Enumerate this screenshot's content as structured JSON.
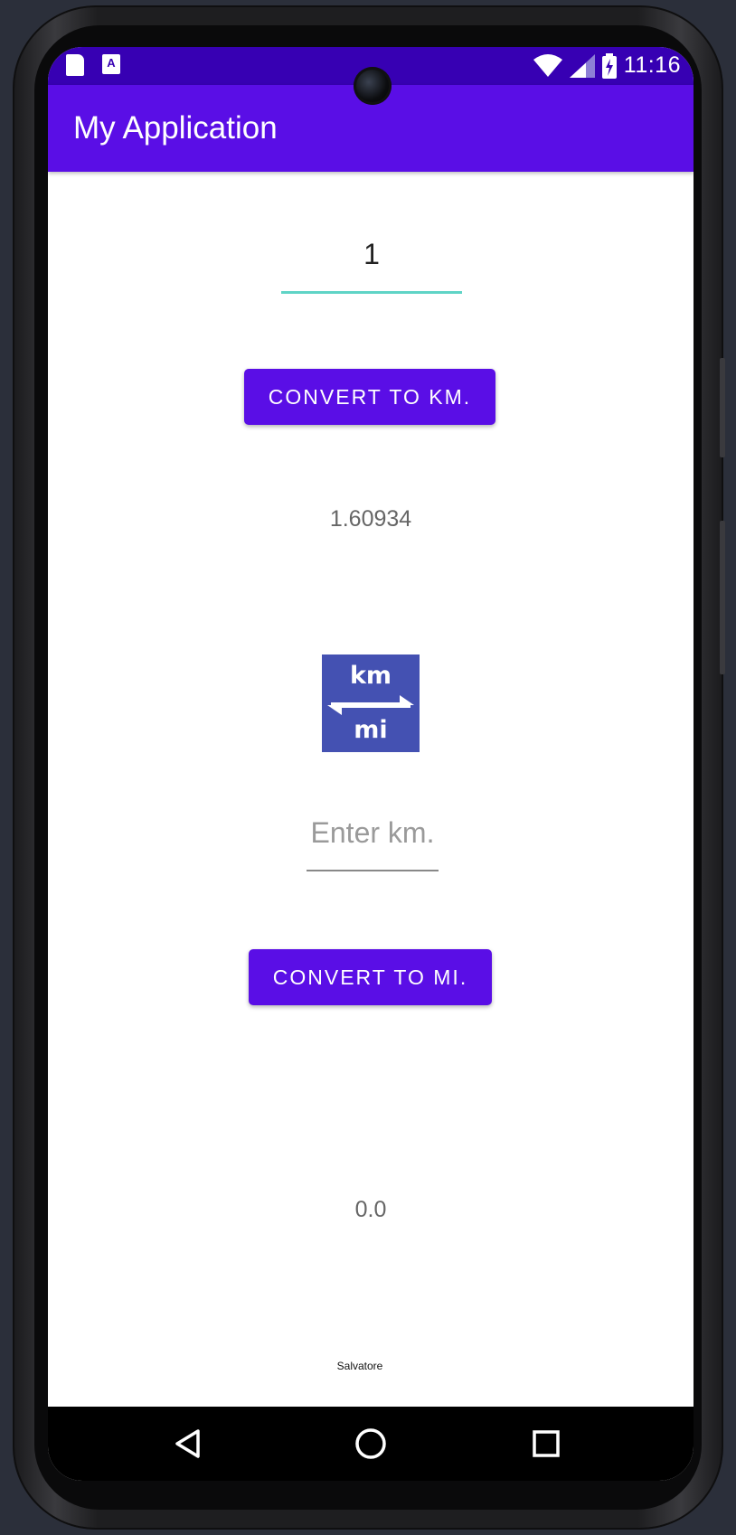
{
  "status_bar": {
    "time": "11:16",
    "icons": [
      "sd-card-icon",
      "a-text-icon",
      "wifi-icon",
      "cell-signal-icon",
      "battery-charging-icon"
    ]
  },
  "app_bar": {
    "title": "My Application"
  },
  "miles_input": {
    "value": "1"
  },
  "convert_km_button": {
    "label": "CONVERT TO KM."
  },
  "km_result": "1.60934",
  "logo": {
    "top_text": "km",
    "bottom_text": "mi"
  },
  "km_input": {
    "value": "",
    "placeholder": "Enter km."
  },
  "convert_mi_button": {
    "label": "CONVERT TO MI."
  },
  "mi_result": "0.0",
  "signature": "Salvatore",
  "colors": {
    "primary": "#5a0ee6",
    "primary_dark": "#3700b3",
    "accent": "#5fd4c6",
    "logo_bg": "#4451b2"
  },
  "nav_bar": {
    "icons": [
      "back-icon",
      "home-icon",
      "recents-icon"
    ]
  }
}
